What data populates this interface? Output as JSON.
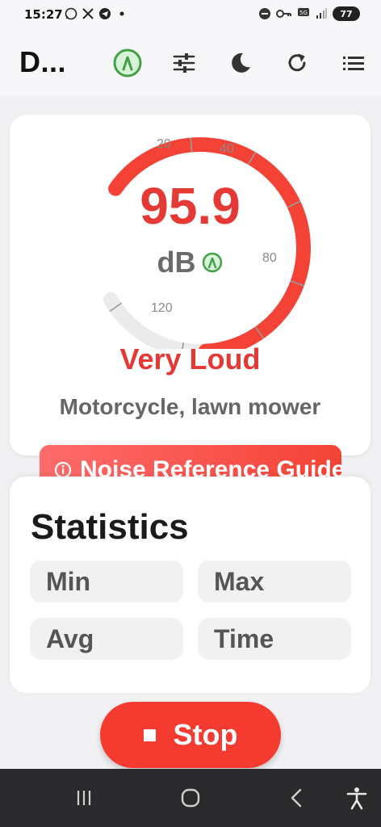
{
  "status_bar": {
    "time": "15:27",
    "battery": "77"
  },
  "app_bar": {
    "title": "D...",
    "accent_color": "#43a047",
    "icons": [
      "sensor-indicator-icon",
      "sliders-icon",
      "moon-icon",
      "refresh-icon",
      "list-icon"
    ]
  },
  "meter": {
    "reading": "95.9",
    "unit": "dB",
    "level": "Very Loud",
    "example": "Motorcycle, lawn mower",
    "tick_labels": [
      "20",
      "40",
      "80",
      "120"
    ],
    "fill_fraction": 0.8,
    "active_color": "#f44336",
    "track_color": "#ebebeb"
  },
  "guide": {
    "label": "Noise Reference Guide"
  },
  "stats": {
    "title": "Statistics",
    "min_label": "Min",
    "max_label": "Max",
    "avg_label": "Avg",
    "time_label": "Time"
  },
  "controls": {
    "stop_label": "Stop"
  }
}
